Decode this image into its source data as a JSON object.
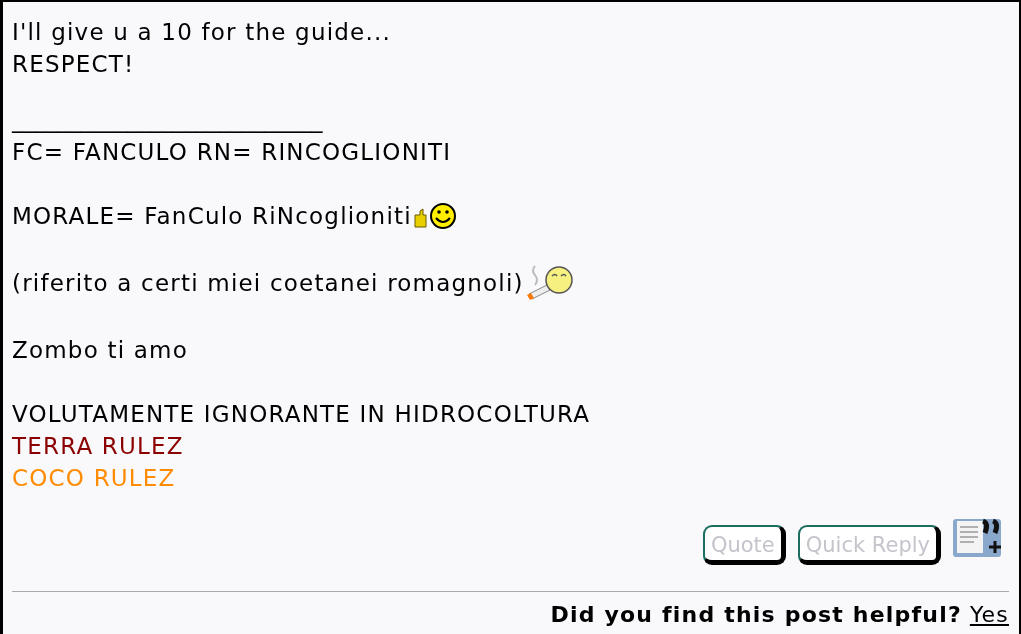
{
  "post": {
    "message": [
      "I'll give u a 10 for the guide...",
      "RESPECT!"
    ],
    "signature": {
      "rule": "___________________________",
      "blocks": [
        {
          "lines": [
            {
              "text": "FC= FANCULO RN= RINCOGLIONITI",
              "color": "#000000"
            }
          ]
        },
        {
          "lines": [
            {
              "text": "MORALE= FanCulo RiNcoglioniti",
              "color": "#000000",
              "kind": "thumbs-up"
            }
          ]
        },
        {
          "lines": [
            {
              "text": "(riferito a certi miei coetanei romagnoli)",
              "color": "#000000",
              "kind": "smoking"
            }
          ]
        },
        {
          "lines": [
            {
              "text": "Zombo ti amo",
              "color": "#000000"
            }
          ]
        },
        {
          "lines": [
            {
              "text": "VOLUTAMENTE IGNORANTE IN HIDROCOLTURA",
              "color": "#000000"
            },
            {
              "text": "TERRA RULEZ",
              "color": "#8b0000"
            },
            {
              "text": "COCO RULEZ",
              "color": "#ff8c00"
            }
          ]
        }
      ]
    }
  },
  "buttons": [
    "Quote",
    "Quick Reply"
  ],
  "helpful": {
    "question": "Did you find this post helpful?",
    "answer": "Yes"
  }
}
